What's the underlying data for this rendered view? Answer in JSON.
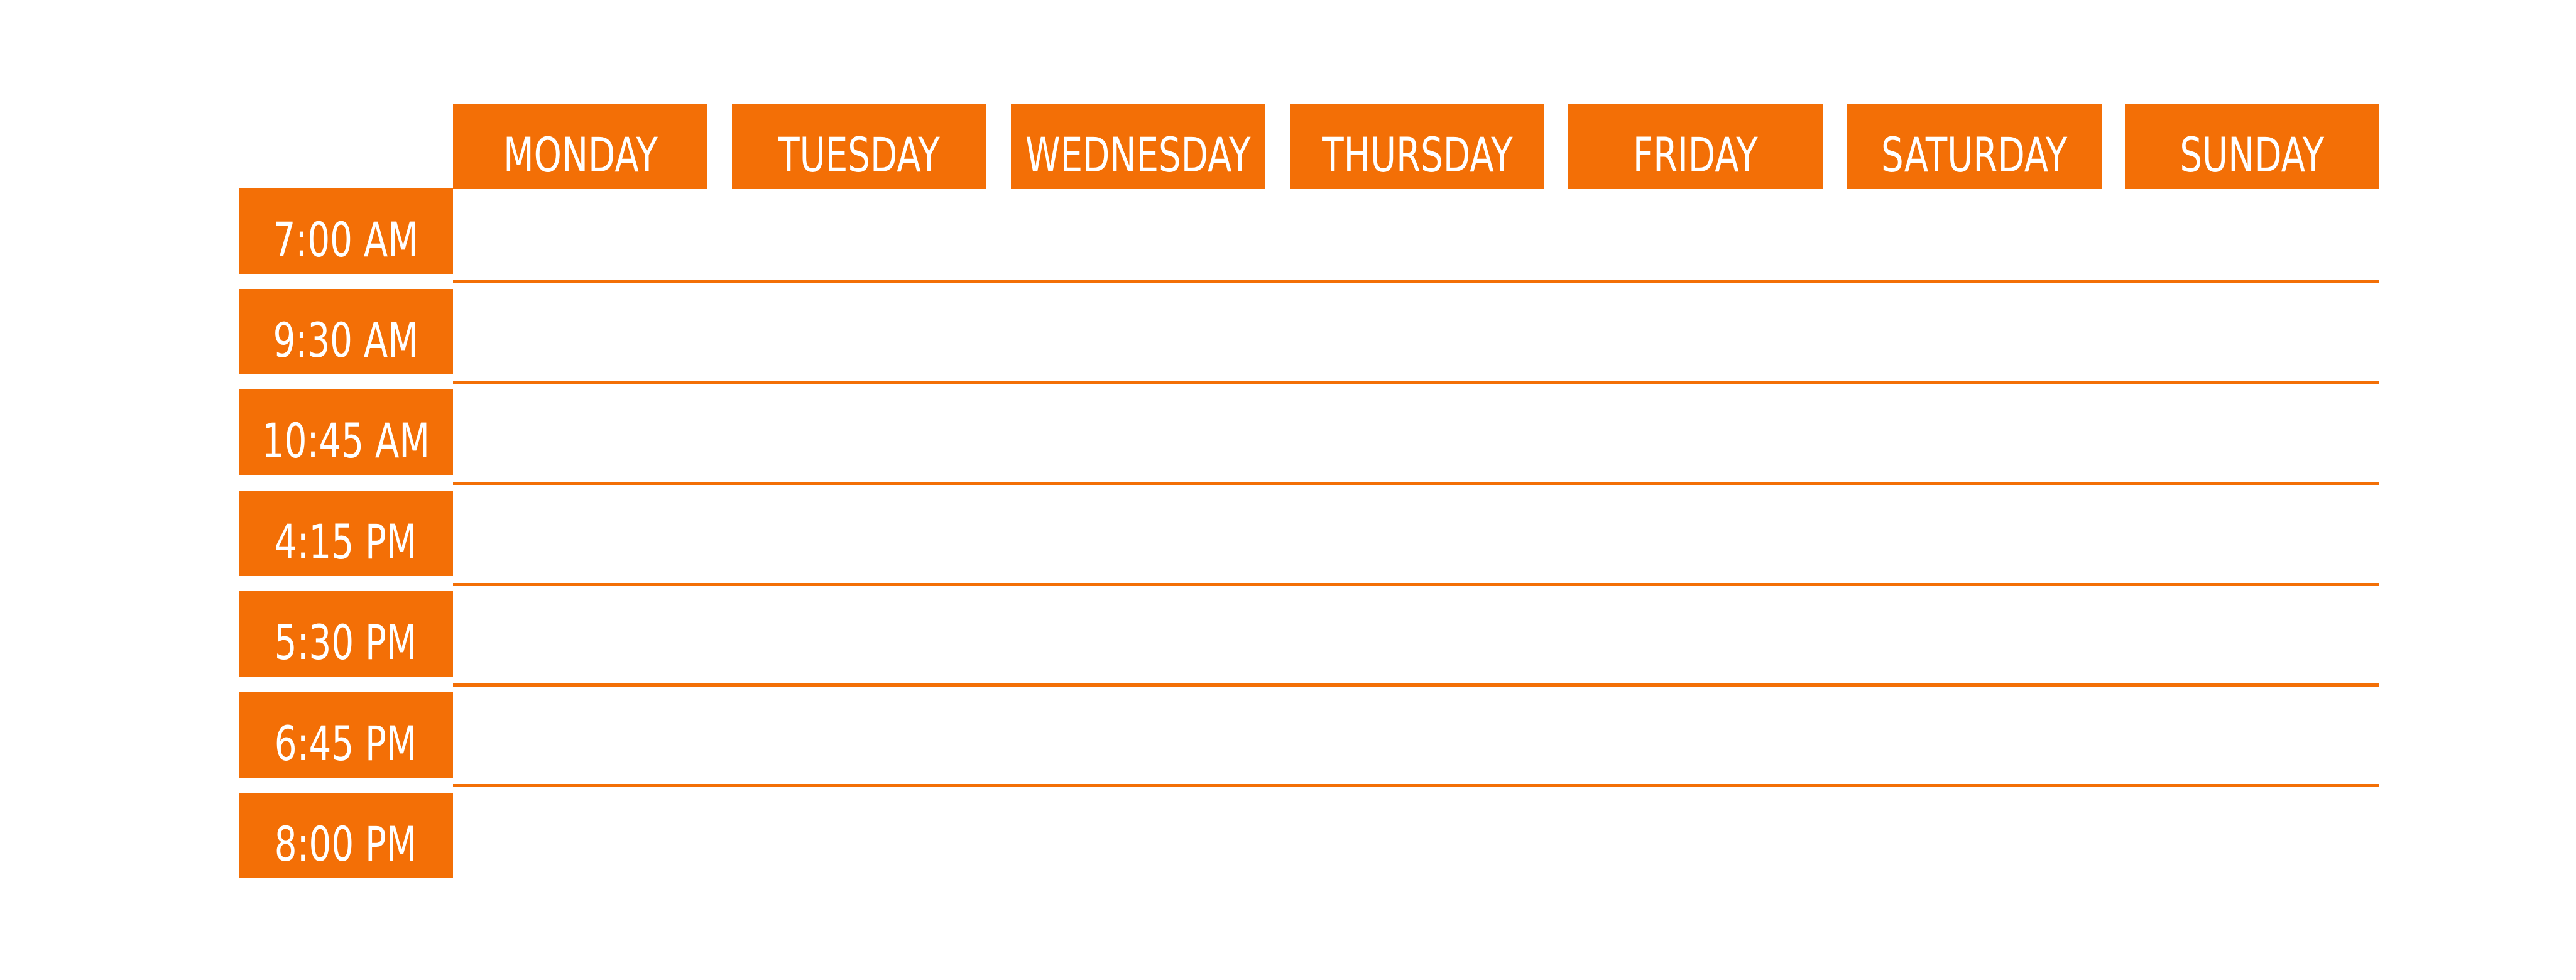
{
  "theme": {
    "accent": "#F36F06",
    "background": "#FFFFFF",
    "label_text": "#FFFFFF"
  },
  "schedule": {
    "days": [
      "MONDAY",
      "TUESDAY",
      "WEDNESDAY",
      "THURSDAY",
      "FRIDAY",
      "SATURDAY",
      "SUNDAY"
    ],
    "times": [
      "7:00 AM",
      "9:30 AM",
      "10:45 AM",
      "4:15 PM",
      "5:30 PM",
      "6:45 PM",
      "8:00 PM"
    ]
  }
}
